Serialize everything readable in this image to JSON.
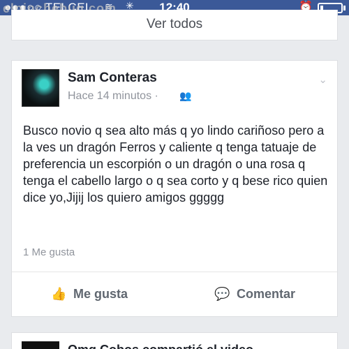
{
  "status_bar": {
    "carrier": "●●●○○ TELCEL",
    "time": "12:40",
    "wifi_icon": "wifi-icon",
    "activity_icon": "spinner-icon",
    "alarm_icon": "alarm-icon",
    "battery_icon": "battery-icon",
    "battery_level": 0.15
  },
  "watermark": "elpinchebug.com",
  "previous_card": {
    "see_all_label": "Ver todos"
  },
  "post": {
    "author": "Sam Conteras",
    "time_ago": "Hace 14 minutos",
    "separator": "·",
    "privacy_icon": "friends-icon",
    "text": "Busco novio q sea alto más q yo lindo cariñoso pero a la ves un dragón Ferros y caliente q tenga tatuaje de preferencia un escorpión o un dragón o una rosa q tenga el cabello largo o q sea corto y q bese rico quien dice yo,Jijij los quiero amigos ggggg",
    "likes_count": "1 Me gusta",
    "actions": {
      "like_label": "Me gusta",
      "comment_label": "Comentar"
    }
  },
  "next_card": {
    "text": "Omg Cobos compartió el video"
  }
}
